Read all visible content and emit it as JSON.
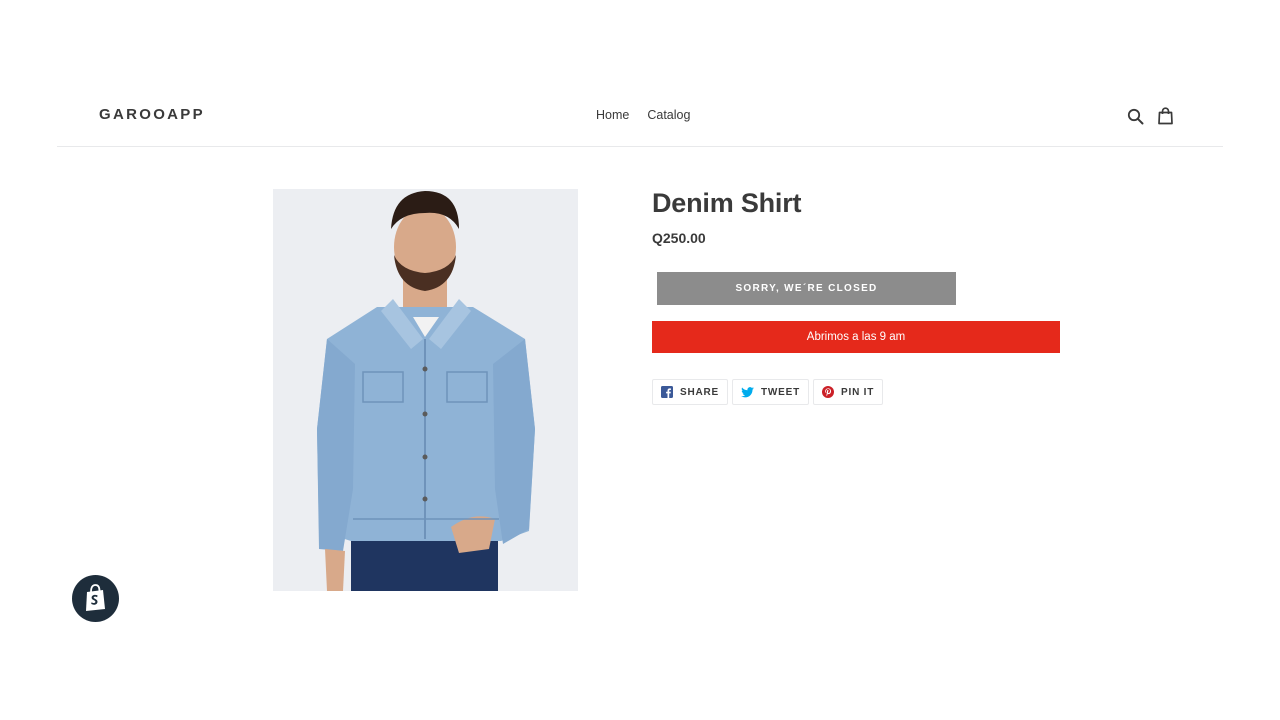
{
  "header": {
    "logo": "GAROOAPP",
    "nav": [
      {
        "label": "Home"
      },
      {
        "label": "Catalog"
      }
    ],
    "icons": {
      "search": "search-icon",
      "cart": "cart-icon"
    }
  },
  "product": {
    "title": "Denim Shirt",
    "price": "Q250.00",
    "image": "man-in-light-blue-denim-jacket-photo",
    "status_button": "SORRY, WE´RE CLOSED",
    "notice": "Abrimos a las 9 am",
    "notice_color": "#e5291b"
  },
  "social": {
    "share": "SHARE",
    "tweet": "TWEET",
    "pin": "PIN IT",
    "colors": {
      "facebook": "#3b5998",
      "twitter": "#00aced",
      "pinterest": "#cb2027"
    }
  },
  "badge": {
    "icon": "shopify-bag-icon"
  }
}
